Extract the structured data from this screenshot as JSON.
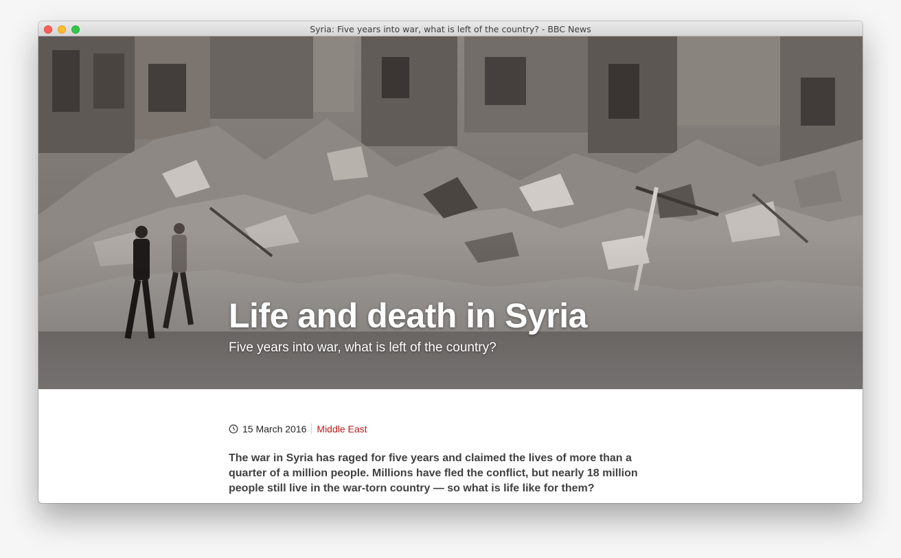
{
  "window": {
    "title": "Syria: Five years into war, what is left of the country? - BBC News"
  },
  "hero": {
    "title": "Life and death in Syria",
    "subtitle": "Five years into war, what is left of the country?"
  },
  "article": {
    "date": "15 March 2016",
    "section": "Middle East",
    "intro": "The war in Syria has raged for five years and claimed the lives of more than a quarter of a million people. Millions have fled the conflict, but nearly 18 million people still live in the war-torn country — so what is life like for them?"
  },
  "colors": {
    "section_link": "#bb1919",
    "hero_text": "#ffffff",
    "intro_text": "#404040"
  }
}
